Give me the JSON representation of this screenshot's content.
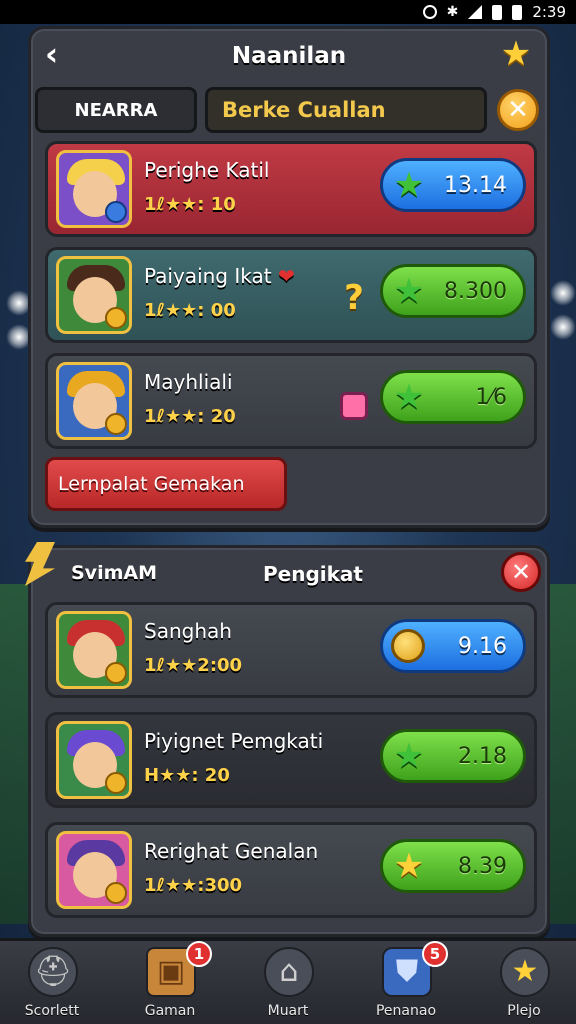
{
  "status_bar": {
    "time": "2:39"
  },
  "top_panel": {
    "title": "Naanilan",
    "tabs": {
      "near_label": "NEARRA",
      "search_label": "Berke Cuallan"
    },
    "heroes": [
      {
        "name": "Perighe Katil",
        "stats": "1ℓ★★: 10",
        "price": "13.14",
        "price_icon": "star-icon",
        "button_color": "blue"
      },
      {
        "name": "Paiyaing Ikat",
        "stats": "1ℓ★★: 00",
        "price": "8.300",
        "price_icon": "star-icon",
        "button_color": "green",
        "side_icon": "question-icon"
      },
      {
        "name": "Mayhliali",
        "stats": "1ℓ★★: 20",
        "price": "1⁄6",
        "price_icon": "star-icon",
        "button_color": "green",
        "side_icon": "gem-icon"
      }
    ],
    "action_button": "Lernpalat Gemakan"
  },
  "bottom_panel": {
    "label_left": "SvimAM",
    "title": "Pengikat",
    "heroes": [
      {
        "name": "Sanghah",
        "stats": "1ℓ★★2:00",
        "price": "9.16",
        "price_icon": "coin-icon",
        "button_color": "blue"
      },
      {
        "name": "Piyignet Pemgkati",
        "stats": "H★★: 20",
        "price": "2.18",
        "price_icon": "star-icon",
        "button_color": "green"
      },
      {
        "name": "Rerighat Genalan",
        "stats": "1ℓ★★:300",
        "price": "8.39",
        "price_icon": "star-icon",
        "button_color": "green"
      }
    ]
  },
  "bottom_nav": [
    {
      "label": "Scorlett",
      "icon": "helmet-icon"
    },
    {
      "label": "Gaman",
      "icon": "chest-icon",
      "badge": "1"
    },
    {
      "label": "Muart",
      "icon": "house-icon"
    },
    {
      "label": "Penanao",
      "icon": "shield-icon",
      "badge": "5"
    },
    {
      "label": "Plejo",
      "icon": "star-icon"
    }
  ],
  "colors": {
    "panel": "#3a3d45",
    "gold": "#ffd24a",
    "card_red": "#c03a44",
    "card_teal": "#3f6a6e",
    "button_blue": "#1d6fe0",
    "button_green": "#3fa21c"
  }
}
